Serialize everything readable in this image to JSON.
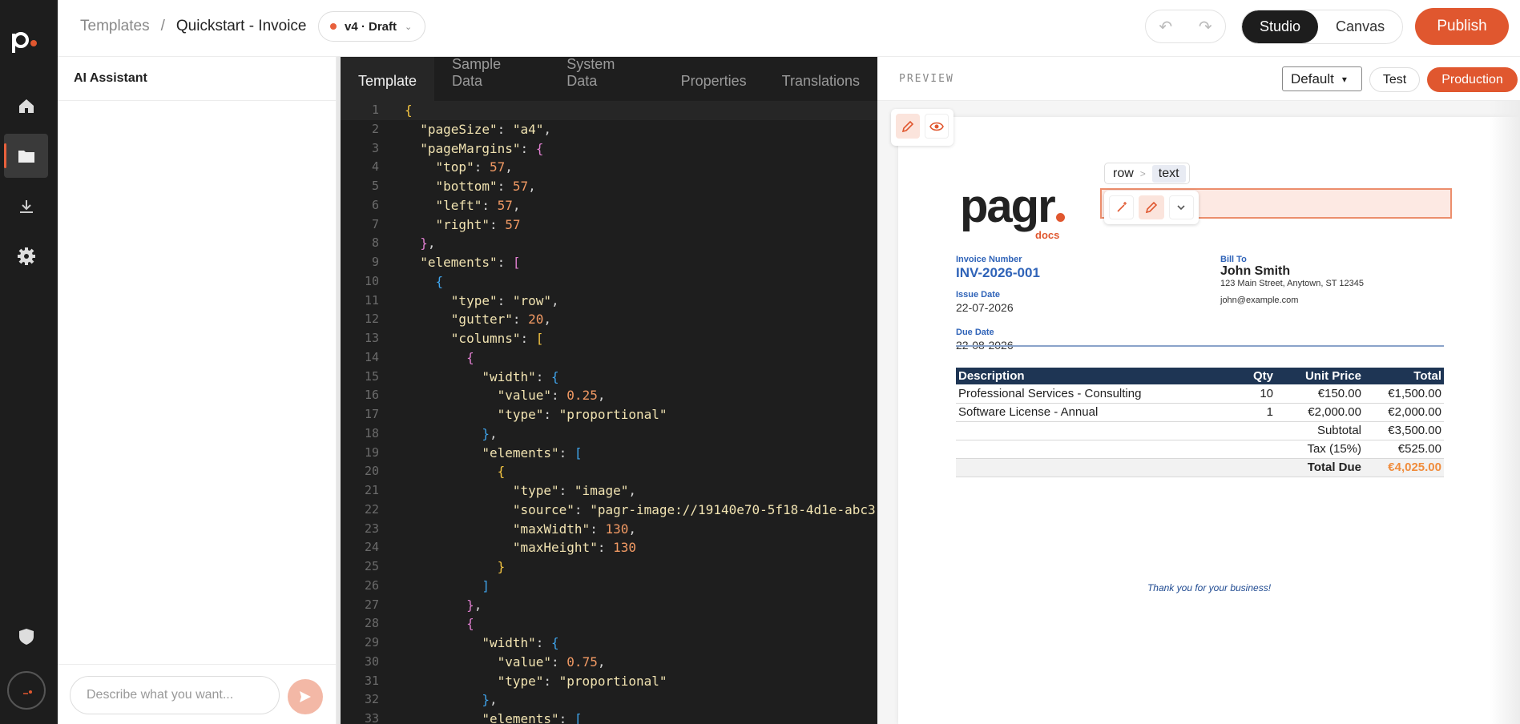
{
  "breadcrumb": {
    "root": "Templates",
    "separator": "/",
    "current": "Quickstart - Invoice"
  },
  "version": {
    "label": "v4 · Draft",
    "status_color": "#e0572f"
  },
  "mode": {
    "studio": "Studio",
    "canvas": "Canvas",
    "active": "Studio"
  },
  "publish_label": "Publish",
  "ai_panel": {
    "title": "AI Assistant",
    "placeholder": "Describe what you want..."
  },
  "editor_tabs": [
    "Template",
    "Sample Data",
    "System Data",
    "Properties",
    "Translations"
  ],
  "editor_active_tab": "Template",
  "code_lines": [
    "{",
    "  \"pageSize\": \"a4\",",
    "  \"pageMargins\": {",
    "    \"top\": 57,",
    "    \"bottom\": 57,",
    "    \"left\": 57,",
    "    \"right\": 57",
    "  },",
    "  \"elements\": [",
    "    {",
    "      \"type\": \"row\",",
    "      \"gutter\": 20,",
    "      \"columns\": [",
    "        {",
    "          \"width\": {",
    "            \"value\": 0.25,",
    "            \"type\": \"proportional\"",
    "          },",
    "          \"elements\": [",
    "            {",
    "              \"type\": \"image\",",
    "              \"source\": \"pagr-image://19140e70-5f18-4d1e-abc3",
    "              \"maxWidth\": 130,",
    "              \"maxHeight\": 130",
    "            }",
    "          ]",
    "        },",
    "        {",
    "          \"width\": {",
    "            \"value\": 0.75,",
    "            \"type\": \"proportional\"",
    "          },",
    "          \"elements\": ["
  ],
  "preview": {
    "label": "PREVIEW",
    "theme_select": "Default",
    "test_label": "Test",
    "production_label": "Production",
    "selection_crumbs": [
      "row",
      ">",
      "text"
    ]
  },
  "invoice": {
    "brand_word": "pagr",
    "brand_sub": "docs",
    "invoice_number_label": "Invoice Number",
    "invoice_number": "INV-2026-001",
    "issue_date_label": "Issue Date",
    "issue_date": "22-07-2026",
    "due_date_label": "Due Date",
    "due_date": "22-08-2026",
    "bill_to_label": "Bill To",
    "bill_to_name": "John Smith",
    "bill_to_address": "123 Main Street, Anytown, ST 12345",
    "bill_to_email": "john@example.com",
    "table_headers": [
      "Description",
      "Qty",
      "Unit Price",
      "Total"
    ],
    "rows": [
      [
        "Professional Services - Consulting",
        "10",
        "€150.00",
        "€1,500.00"
      ],
      [
        "Software License - Annual",
        "1",
        "€2,000.00",
        "€2,000.00"
      ]
    ],
    "subtotal_label": "Subtotal",
    "subtotal": "€3,500.00",
    "tax_label": "Tax (15%)",
    "tax": "€525.00",
    "total_due_label": "Total Due",
    "total_due": "€4,025.00",
    "thanks": "Thank you for your business!"
  },
  "colors": {
    "accent": "#e0572f",
    "rail_bg": "#1d1d1d",
    "editor_bg": "#1e1e1e",
    "invoice_blue": "#2f63b8",
    "table_header": "#1e3554"
  }
}
